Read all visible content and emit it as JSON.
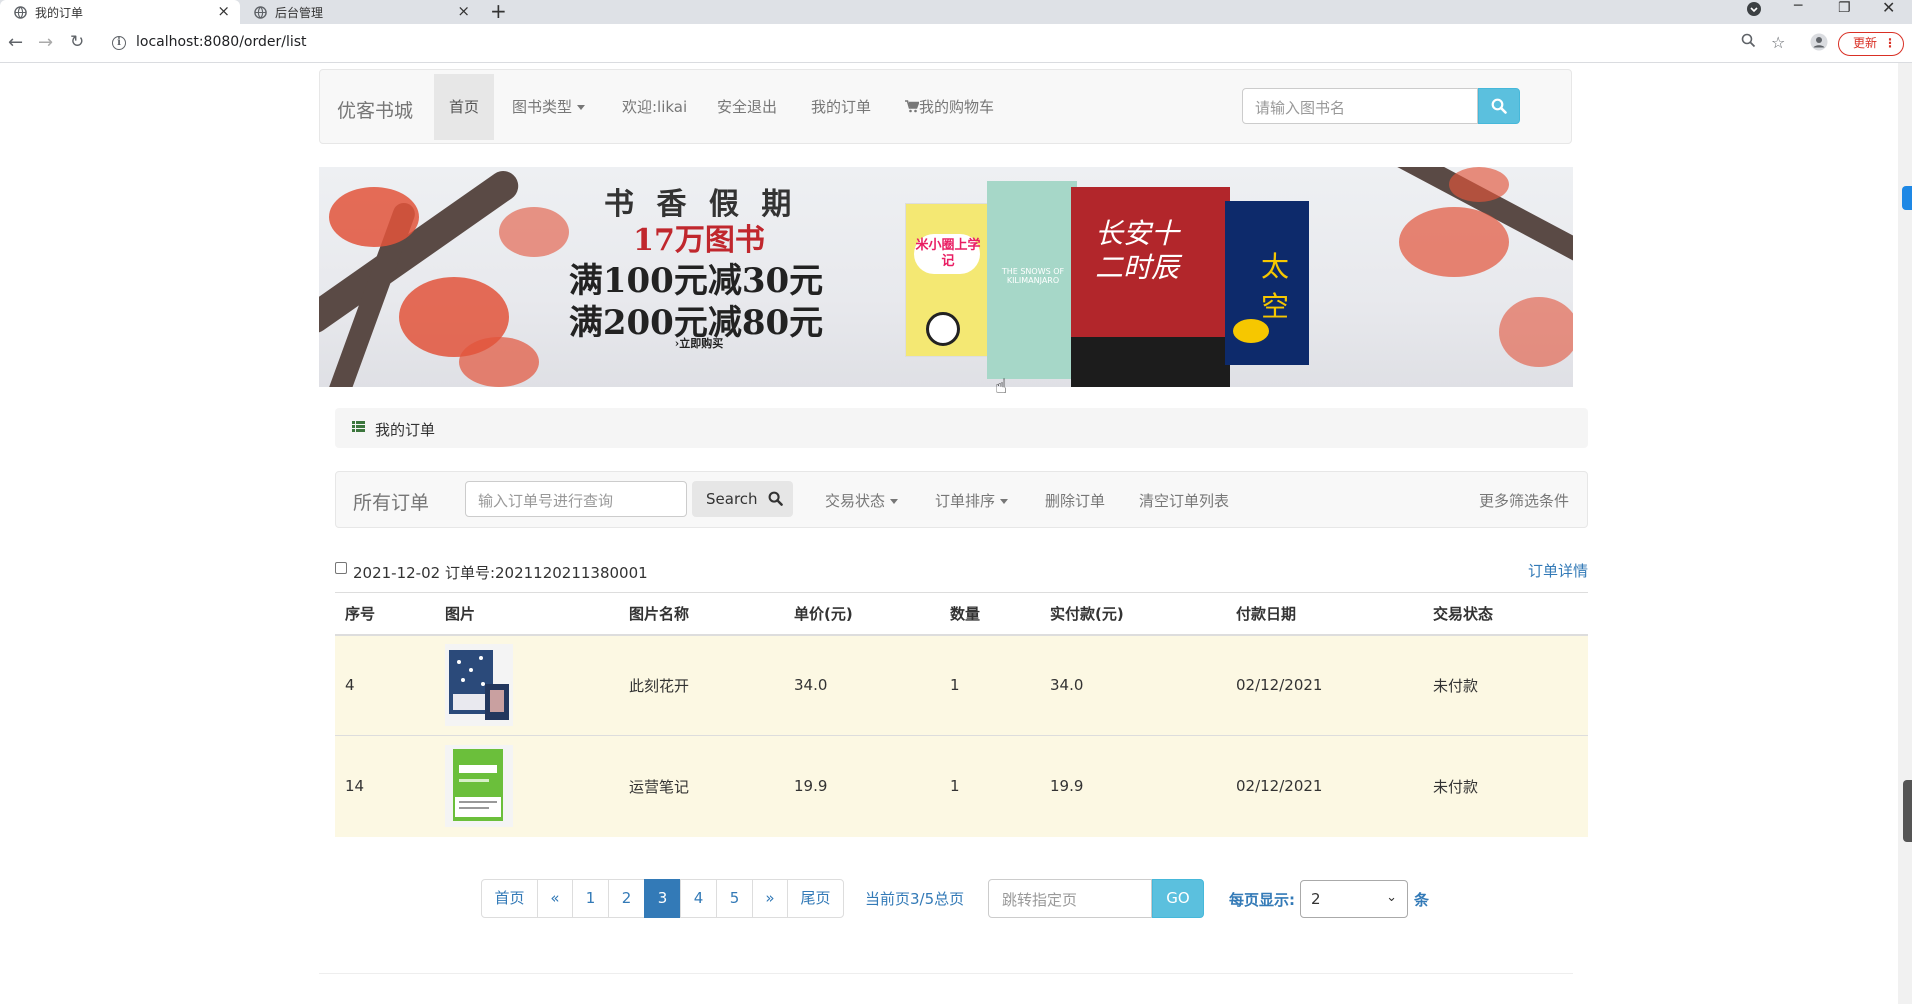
{
  "browser": {
    "tabs": [
      {
        "title": "我的订单",
        "active": true
      },
      {
        "title": "后台管理",
        "active": false
      }
    ],
    "url": "localhost:8080/order/list",
    "update_label": "更新"
  },
  "navbar": {
    "brand": "优客书城",
    "items": [
      "首页",
      "图书类型",
      "欢迎:likai",
      "安全退出",
      "我的订单",
      "我的购物车"
    ],
    "search_placeholder": "请输入图书名"
  },
  "banner": {
    "line1": "书 香 假 期",
    "line2": "17万图书",
    "line3": "满100元减30元",
    "line4": "满200元减80元",
    "cta": "›立即购买",
    "book_titles": [
      "米小圈上学记",
      "THE SNOWS OF KILIMANJARO",
      "长安十二时辰",
      "太空"
    ]
  },
  "breadcrumb": {
    "label": "我的订单"
  },
  "filter": {
    "title": "所有订单",
    "input_placeholder": "输入订单号进行查询",
    "search_label": "Search",
    "items": [
      "交易状态",
      "订单排序",
      "删除订单",
      "清空订单列表"
    ],
    "more": "更多筛选条件"
  },
  "order": {
    "meta": "2021-12-02 订单号:2021120211380001",
    "detail_link": "订单详情",
    "columns": [
      "序号",
      "图片",
      "图片名称",
      "单价(元)",
      "数量",
      "实付款(元)",
      "付款日期",
      "交易状态"
    ],
    "rows": [
      {
        "id": "4",
        "name": "此刻花开",
        "price": "34.0",
        "qty": "1",
        "paid": "34.0",
        "date": "02/12/2021",
        "status": "未付款"
      },
      {
        "id": "14",
        "name": "运营笔记",
        "price": "19.9",
        "qty": "1",
        "paid": "19.9",
        "date": "02/12/2021",
        "status": "未付款"
      }
    ]
  },
  "pagination": {
    "first": "首页",
    "prev": "«",
    "pages": [
      "1",
      "2",
      "3",
      "4",
      "5"
    ],
    "current": "3",
    "next": "»",
    "last": "尾页",
    "info": "当前页3/5总页",
    "jump_placeholder": "跳转指定页",
    "go": "GO",
    "per_page_label": "每页显示:",
    "per_page_value": "2",
    "per_page_unit": "条"
  },
  "colors": {
    "accent": "#337ab7",
    "info": "#5bc0de",
    "row_highlight": "#fcf8e3"
  }
}
